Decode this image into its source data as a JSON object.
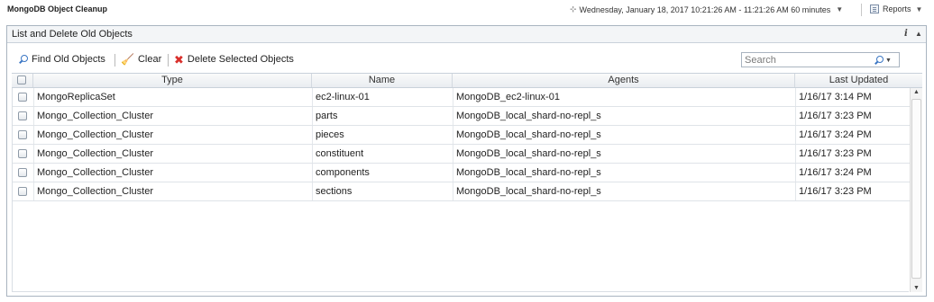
{
  "header": {
    "title": "MongoDB Object Cleanup",
    "timeframe": "Wednesday, January 18, 2017 10:21:26 AM - 11:21:26 AM 60 minutes",
    "reports_label": "Reports"
  },
  "panel": {
    "title": "List and Delete Old Objects"
  },
  "toolbar": {
    "find_label": "Find Old Objects",
    "clear_label": "Clear",
    "delete_label": "Delete Selected Objects"
  },
  "search": {
    "placeholder": "Search"
  },
  "table": {
    "columns": [
      "Type",
      "Name",
      "Agents",
      "Last Updated"
    ],
    "rows": [
      [
        "MongoReplicaSet",
        "ec2-linux-01",
        "MongoDB_ec2-linux-01",
        "1/16/17 3:14 PM"
      ],
      [
        "Mongo_Collection_Cluster",
        "parts",
        "MongoDB_local_shard-no-repl_s",
        "1/16/17 3:23 PM"
      ],
      [
        "Mongo_Collection_Cluster",
        "pieces",
        "MongoDB_local_shard-no-repl_s",
        "1/16/17 3:24 PM"
      ],
      [
        "Mongo_Collection_Cluster",
        "constituent",
        "MongoDB_local_shard-no-repl_s",
        "1/16/17 3:23 PM"
      ],
      [
        "Mongo_Collection_Cluster",
        "components",
        "MongoDB_local_shard-no-repl_s",
        "1/16/17 3:24 PM"
      ],
      [
        "Mongo_Collection_Cluster",
        "sections",
        "MongoDB_local_shard-no-repl_s",
        "1/16/17 3:23 PM"
      ]
    ]
  },
  "icons": {
    "timeframe": "clock-icon",
    "reports": "report-icon",
    "info": "info-icon",
    "collapse": "collapse-icon",
    "find": "magnifier-icon",
    "clear": "broom-icon",
    "delete": "red-x-icon",
    "search": "search-icon"
  },
  "colors": {
    "delete_icon": "#d9302c",
    "find_icon": "#3a76c4",
    "panel_border": "#a9b4c0"
  }
}
